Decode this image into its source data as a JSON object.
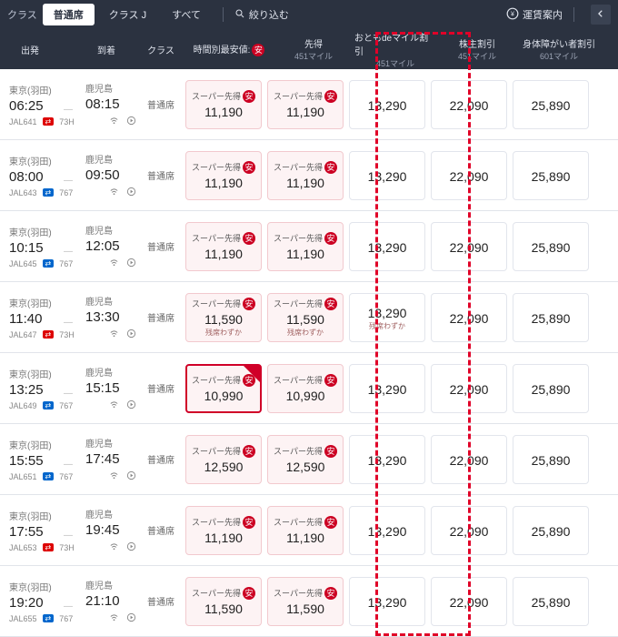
{
  "topbar": {
    "class_label": "クラス",
    "filter_label": "絞り込む",
    "fare_guide_label": "運賃案内",
    "tabs": [
      "普通席",
      "クラス J",
      "すべて"
    ]
  },
  "header": {
    "dep": "出発",
    "arr": "到着",
    "cls": "クラス",
    "saku": "時間別最安値:",
    "cols": [
      {
        "title": "先得",
        "miles": "451マイル"
      },
      {
        "title": "おともdeマイル割引",
        "miles": "451マイル"
      },
      {
        "title": "株主割引",
        "miles": "451マイル"
      },
      {
        "title": "身体障がい者割引",
        "miles": "601マイル"
      }
    ]
  },
  "shared": {
    "dep_ap": "東京(羽田)",
    "arr_ap": "鹿児島",
    "cabin": "普通席",
    "super_label": "スーパー先得",
    "few_seats": "残席わずか"
  },
  "flights": [
    {
      "dep": "06:25",
      "arr": "08:15",
      "code": "JAL641",
      "acBadge": "73H",
      "saku": "11,190",
      "sakidoku": "11,190",
      "otomo": "13,290",
      "kabu": "22,090",
      "shintai": "25,890"
    },
    {
      "dep": "08:00",
      "arr": "09:50",
      "code": "JAL643",
      "acBadge": "767",
      "saku": "11,190",
      "sakidoku": "11,190",
      "otomo": "13,290",
      "kabu": "22,090",
      "shintai": "25,890"
    },
    {
      "dep": "10:15",
      "arr": "12:05",
      "code": "JAL645",
      "acBadge": "767",
      "saku": "11,190",
      "sakidoku": "11,190",
      "otomo": "13,290",
      "kabu": "22,090",
      "shintai": "25,890"
    },
    {
      "dep": "11:40",
      "arr": "13:30",
      "code": "JAL647",
      "acBadge": "73H",
      "saku": "11,590",
      "sakidoku": "11,590",
      "otomo": "13,290",
      "kabu": "22,090",
      "shintai": "25,890",
      "saku_note": true,
      "sakidoku_note": true,
      "otomo_note": true
    },
    {
      "dep": "13:25",
      "arr": "15:15",
      "code": "JAL649",
      "acBadge": "767",
      "saku": "10,990",
      "sakidoku": "10,990",
      "otomo": "13,290",
      "kabu": "22,090",
      "shintai": "25,890",
      "cheapest": true
    },
    {
      "dep": "15:55",
      "arr": "17:45",
      "code": "JAL651",
      "acBadge": "767",
      "saku": "12,590",
      "sakidoku": "12,590",
      "otomo": "13,290",
      "kabu": "22,090",
      "shintai": "25,890"
    },
    {
      "dep": "17:55",
      "arr": "19:45",
      "code": "JAL653",
      "acBadge": "73H",
      "saku": "11,190",
      "sakidoku": "11,190",
      "otomo": "13,290",
      "kabu": "22,090",
      "shintai": "25,890"
    },
    {
      "dep": "19:20",
      "arr": "21:10",
      "code": "JAL655",
      "acBadge": "767",
      "saku": "11,590",
      "sakidoku": "11,590",
      "otomo": "13,290",
      "kabu": "22,090",
      "shintai": "25,890"
    }
  ]
}
